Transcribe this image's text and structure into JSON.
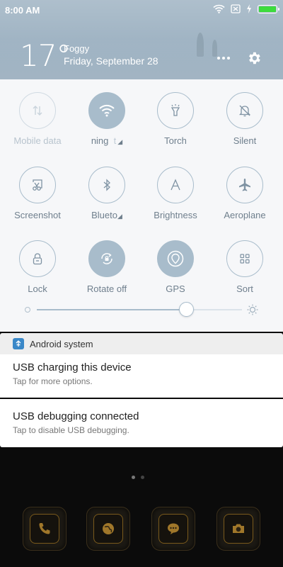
{
  "status_bar": {
    "time": "8:00 AM",
    "battery_level": 1.0,
    "icons": [
      "wifi-icon",
      "sim-off-icon",
      "charging-bolt-icon",
      "battery-icon"
    ]
  },
  "weather": {
    "temperature": "17°",
    "condition": "Foggy",
    "date": "Friday, September 28"
  },
  "quick_settings": {
    "tiles": [
      {
        "label": "Mobile data",
        "icon": "mobile-data-icon",
        "state": "disabled"
      },
      {
        "label": "ning",
        "icon": "wifi-icon",
        "state": "active"
      },
      {
        "label": "Torch",
        "icon": "torch-icon",
        "state": "off"
      },
      {
        "label": "Silent",
        "icon": "bell-icon",
        "state": "off"
      },
      {
        "label": "Screenshot",
        "icon": "screenshot-icon",
        "state": "off"
      },
      {
        "label": "Blueto",
        "icon": "bluetooth-icon",
        "state": "off"
      },
      {
        "label": "Brightness",
        "icon": "auto-brightness-icon",
        "state": "off"
      },
      {
        "label": "Aeroplane",
        "icon": "airplane-icon",
        "state": "off"
      },
      {
        "label": "Lock",
        "icon": "lock-icon",
        "state": "off"
      },
      {
        "label": "Rotate off",
        "icon": "rotate-lock-icon",
        "state": "active"
      },
      {
        "label": "GPS",
        "icon": "gps-icon",
        "state": "active"
      },
      {
        "label": "Sort",
        "icon": "grid-icon",
        "state": "off"
      }
    ],
    "brightness": {
      "value": 0.73
    }
  },
  "notifications": {
    "app_name": "Android system",
    "items": [
      {
        "title": "USB charging this device",
        "subtitle": "Tap for more options."
      },
      {
        "title": "USB debugging connected",
        "subtitle": "Tap to disable USB debugging."
      }
    ]
  },
  "home": {
    "dock": [
      "phone-icon",
      "browser-icon",
      "messages-icon",
      "camera-icon"
    ]
  },
  "colors": {
    "accent": "#a8bccb",
    "tile_label": "#6f7f8d",
    "panel_bg": "#f6f7f9",
    "battery_fill": "#3ddc3d"
  }
}
